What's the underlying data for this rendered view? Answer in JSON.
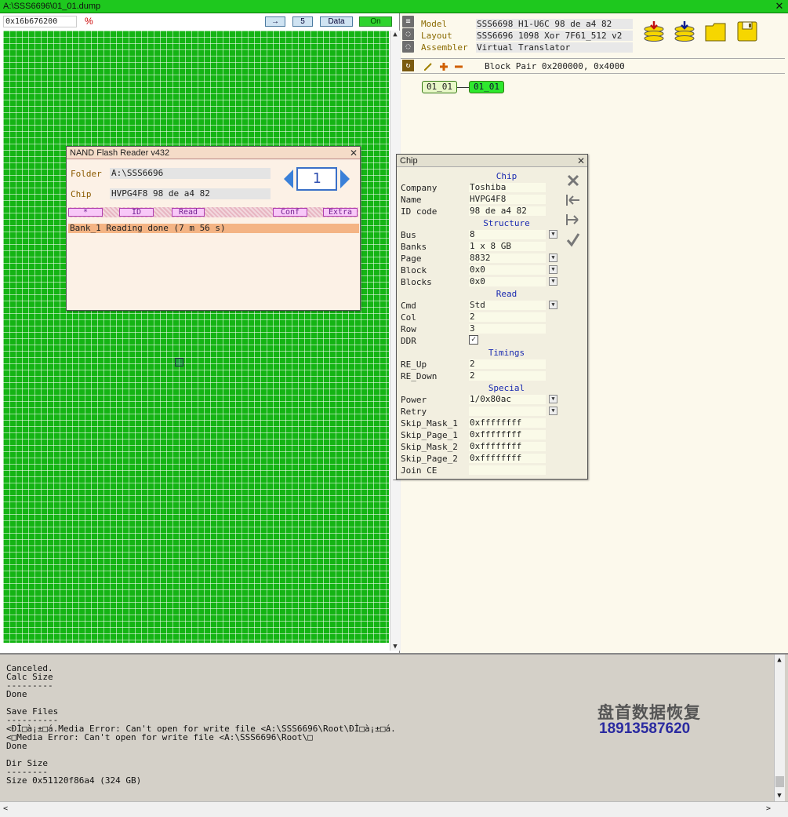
{
  "window": {
    "title": "A:\\SSS6696\\01_01.dump",
    "close": "✕"
  },
  "toolbar": {
    "address": "0x16b676200",
    "percent": "%",
    "arrow_label": "→",
    "step": "5",
    "data_label": "Data",
    "on_label": "On"
  },
  "props": {
    "rows": [
      {
        "label": "Model",
        "value": "SSS6698 H1-U6C  98 de a4 82"
      },
      {
        "label": "Layout",
        "value": "SSS6696 1098 Xor 7F61_512 v2"
      },
      {
        "label": "Assembler",
        "value": "Virtual Translator"
      }
    ]
  },
  "blockpair": {
    "text": "Block Pair 0x200000, 0x4000",
    "nodes": [
      "01_01",
      "01_01"
    ]
  },
  "nand": {
    "title": "NAND Flash Reader v432",
    "folder_label": "Folder",
    "folder_value": "A:\\SSS6696",
    "chip_label": "Chip",
    "chip_value": "HVPG4F8  98 de a4 82",
    "counter": "1",
    "buttons": [
      "*",
      "ID",
      "Read",
      "Conf",
      "Extra"
    ],
    "bank": "Bank_1  Reading done (7 m 56 s)",
    "close": "✕"
  },
  "chip": {
    "title": "Chip",
    "close": "✕",
    "sections": {
      "chip": "Chip",
      "structure": "Structure",
      "read": "Read",
      "timings": "Timings",
      "special": "Special"
    },
    "fields": {
      "company": {
        "label": "Company",
        "value": "Toshiba"
      },
      "name": {
        "label": "Name",
        "value": "HVPG4F8"
      },
      "idcode": {
        "label": "ID code",
        "value": "98 de a4 82"
      },
      "bus": {
        "label": "Bus",
        "value": "8"
      },
      "banks": {
        "label": "Banks",
        "value": "1 x 8 GB"
      },
      "page": {
        "label": "Page",
        "value": "8832"
      },
      "block": {
        "label": "Block",
        "value": "0x0"
      },
      "blocks": {
        "label": "Blocks",
        "value": "0x0"
      },
      "cmd": {
        "label": "Cmd",
        "value": "Std"
      },
      "col": {
        "label": "Col",
        "value": "2"
      },
      "row": {
        "label": "Row",
        "value": "3"
      },
      "ddr": {
        "label": "DDR",
        "value": "✓"
      },
      "re_up": {
        "label": "RE_Up",
        "value": "2"
      },
      "re_down": {
        "label": "RE_Down",
        "value": "2"
      },
      "power": {
        "label": "Power",
        "value": "1/0x80ac"
      },
      "retry": {
        "label": "Retry",
        "value": ""
      },
      "skip_mask_1": {
        "label": "Skip_Mask_1",
        "value": "0xffffffff"
      },
      "skip_page_1": {
        "label": "Skip_Page_1",
        "value": "0xffffffff"
      },
      "skip_mask_2": {
        "label": "Skip_Mask_2",
        "value": "0xffffffff"
      },
      "skip_page_2": {
        "label": "Skip_Page_2",
        "value": "0xffffffff"
      },
      "join_ce": {
        "label": "Join CE",
        "value": ""
      }
    }
  },
  "log": {
    "text": "Canceled.\nCalc Size\n---------\nDone\n\nSave Files\n----------\n<ÐÌ□à¡±□á.Media Error: Can't open for write file <A:\\SSS6696\\Root\\ÐÌ□à¡±□á.\n<□Media Error: Can't open for write file <A:\\SSS6696\\Root\\□\nDone\n\nDir Size\n--------\nSize 0x51120f86a4 (324 GB)"
  },
  "watermark": {
    "name": "盘首数据恢复",
    "phone": "18913587620"
  },
  "colors": {
    "grid": "#14b414",
    "titlebar": "#1ec81e",
    "chip_section": "#1a2ab0"
  }
}
